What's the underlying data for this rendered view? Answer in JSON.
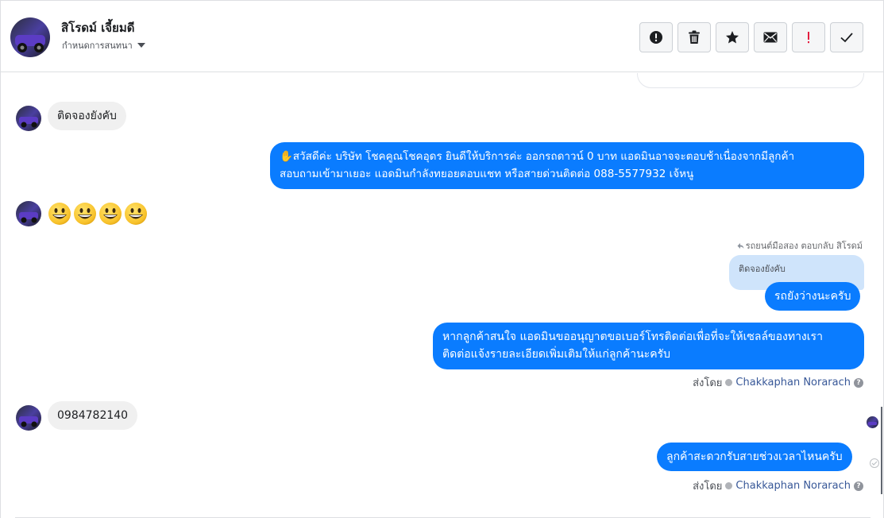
{
  "header": {
    "contact_name": "สิโรดม์ เจี้ยมดี",
    "conversation_settings": "กำหนดการสนทนา",
    "toolbar": [
      {
        "name": "report-spam-button",
        "icon": "exclamation-circle-icon"
      },
      {
        "name": "delete-button",
        "icon": "trash-icon"
      },
      {
        "name": "star-button",
        "icon": "star-icon"
      },
      {
        "name": "mark-unread-button",
        "icon": "envelope-icon"
      },
      {
        "name": "mark-follow-up-button",
        "icon": "exclamation-icon"
      },
      {
        "name": "mark-done-button",
        "icon": "checkmark-icon"
      }
    ]
  },
  "colors": {
    "outgoing_bubble": "#0a7cff",
    "incoming_bubble": "#f0f0f0",
    "quote_bubble": "#cfe4fb",
    "agent_link": "#385898",
    "follow_up_red": "#e41e3f"
  },
  "messages": {
    "in_1": "ติดจองยังคับ",
    "out_1_line1": "✋สวัสดีค่ะ บริษัท โชคคูณโชคอุดร ยินดีให้บริการค่ะ ออกรถดาวน์ 0 บาท แอดมินอาจจะตอบช้าเนื่องจากมีลูกค้า",
    "out_1_line2": "สอบถามเข้ามาเยอะ แอดมินกำลังทยอยตอบแชท หรือสายด่วนติดต่อ 088-5577932 เจ้หนู",
    "in_emoji_count": 4,
    "reply_meta": "รถยนต์มือสอง ตอบกลับ สิโรดม์",
    "reply_quote": "ติดจองยังคับ",
    "out_2": "รถยังว่างนะครับ",
    "out_3_line1": "หากลูกค้าสนใจ แอดมินขออนุญาตขอเบอร์โทรติดต่อเพื่อที่จะให้เซลล์ของทางเรา",
    "out_3_line2": "ติดต่อแจ้งรายละเอียดเพิ่มเติมให้แก่ลูกค้านะครับ",
    "sent_by_label": "ส่งโดย",
    "agent_name": "Chakkaphan Norarach",
    "in_2": "0984782140",
    "out_4": "ลูกค้าสะดวกรับสายช่วงเวลาไหนครับ",
    "sent_by_label_2": "ส่งโดย",
    "agent_name_2": "Chakkaphan Norarach"
  }
}
